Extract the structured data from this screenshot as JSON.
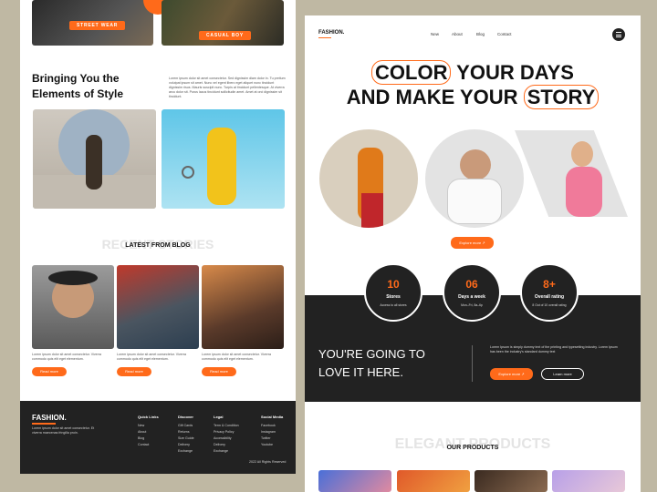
{
  "left": {
    "tag_street": "STREET WEAR",
    "tag_casual": "CASUAL BOY",
    "heading": "Bringing You the Elements of Style",
    "intro": "Lorem ipsum dolor sit amet consectetur. Sed dignissim diam dolor in. Tu pretium volutpat ipsum sit amet. Nunc vel egent libero eget aliquet nunc tincidunt dignissim risus. Mauris suscipit nunc. Turpis at tincidunt pellentesque. At viverra arcu dolor sit. Purus lacus tincidunt sollicitudin amet. Amet at orci dignissim sit tincidunt.",
    "ghost_title": "RECENT STORIES",
    "blog_title": "LATEST FROM BLOG",
    "blog_text": "Lorem ipsum dolor sit amet consectetur. Viverra commodo quis elit eget elementum.",
    "read_more": "Read more",
    "footer": {
      "logo": "FASHION.",
      "about": "Lorem ipsum dolor sit amet consectetur. Et viverra maecenas fringilla proin.",
      "cols": [
        {
          "title": "Quick Links",
          "items": [
            "New",
            "About",
            "Blog",
            "Contact"
          ]
        },
        {
          "title": "Discover",
          "items": [
            "Gift Cards",
            "Returns",
            "Size Guide",
            "Delivery",
            "Exchange"
          ]
        },
        {
          "title": "Legal",
          "items": [
            "Term & Condition",
            "Privacy Policy",
            "Accessibility",
            "Delivery",
            "Exchange"
          ]
        },
        {
          "title": "Social Media",
          "items": [
            "Facebook",
            "Instagram",
            "Twitter",
            "Youtube"
          ]
        }
      ],
      "copyright": "2022 All Rights Reserved"
    }
  },
  "right": {
    "logo": "FASHION.",
    "nav": [
      "New",
      "About",
      "Blog",
      "Contact"
    ],
    "hero_line1_a": "COLOR",
    "hero_line1_b": " YOUR DAYS",
    "hero_line2_a": "AND MAKE YOUR ",
    "hero_line2_b": "STORY",
    "explore": "Explore more ↗",
    "stats": [
      {
        "n": "10",
        "l": "Stores",
        "s": "Access to all stores"
      },
      {
        "n": "06",
        "l": "Days a week",
        "s": "Mon–Fri, 8a–6p"
      },
      {
        "n": "8+",
        "l": "Overall rating",
        "s": "8 Out of 10 overall rating"
      }
    ],
    "love": "YOU'RE GOING TO LOVE IT HERE.",
    "love_text": "Lorem Ipsum is simply dummy text of the printing and typesetting industry. Lorem Ipsum has been the industry's standard dummy text",
    "explore2": "Explore more ↗",
    "learn": "Learn more",
    "ghost_products": "ELEGANT PRODUCTS",
    "products_title": "OUR PRODUCTS"
  },
  "colors": {
    "accent": "#ff6a1a",
    "dark": "#222222",
    "bg": "#bfb8a3"
  }
}
